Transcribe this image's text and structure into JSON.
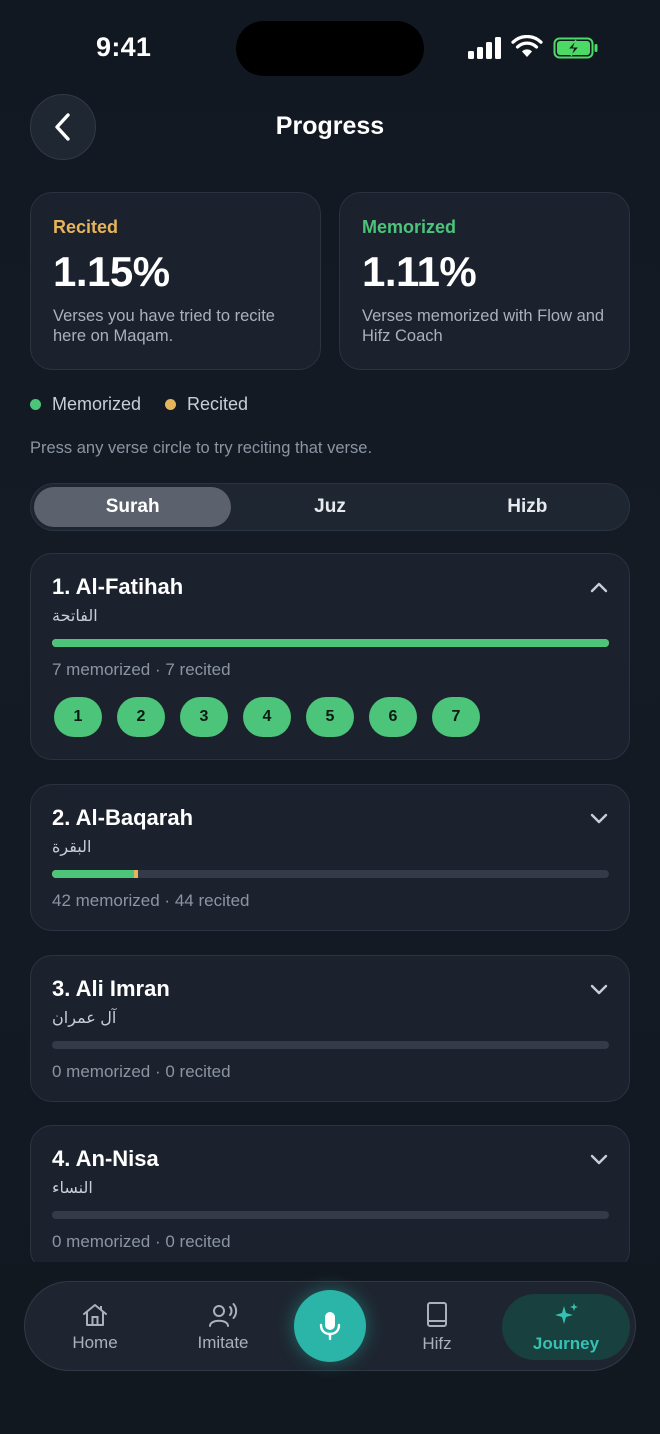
{
  "status_bar": {
    "time": "9:41"
  },
  "header": {
    "title": "Progress",
    "back_icon": "chevron-left-icon"
  },
  "stats": {
    "recited": {
      "label": "Recited",
      "value": "1.15%",
      "description": "Verses you have tried to recite here on Maqam.",
      "color": "#e6b45a"
    },
    "memorized": {
      "label": "Memorized",
      "value": "1.11%",
      "description": "Verses memorized with Flow and Hifz Coach",
      "color": "#4cc47a"
    }
  },
  "legend": {
    "memorized": "Memorized",
    "recited": "Recited"
  },
  "hint": "Press any verse circle to try reciting that verse.",
  "tabs": {
    "items": [
      "Surah",
      "Juz",
      "Hizb"
    ],
    "selected": "Surah"
  },
  "surahs": [
    {
      "name": "1. Al-Fatihah",
      "arabic": "الفاتحة",
      "counts": "7 memorized · 7 recited",
      "memorized_fraction": 1.0,
      "recited_fraction": 1.0,
      "expanded": true,
      "verses": [
        "1",
        "2",
        "3",
        "4",
        "5",
        "6",
        "7"
      ]
    },
    {
      "name": "2. Al-Baqarah",
      "arabic": "البقرة",
      "counts": "42 memorized · 44 recited",
      "memorized_fraction": 0.147,
      "recited_fraction": 0.154,
      "expanded": false
    },
    {
      "name": "3. Ali Imran",
      "arabic": "آل عمران",
      "counts": "0 memorized · 0 recited",
      "memorized_fraction": 0,
      "recited_fraction": 0,
      "expanded": false
    },
    {
      "name": "4. An-Nisa",
      "arabic": "النساء",
      "counts": "0 memorized · 0 recited",
      "memorized_fraction": 0,
      "recited_fraction": 0,
      "expanded": false
    }
  ],
  "bottom_nav": {
    "home": "Home",
    "imitate": "Imitate",
    "hifz": "Hifz",
    "journey": "Journey",
    "active": "Journey",
    "accent_color": "#2ab5a8"
  }
}
